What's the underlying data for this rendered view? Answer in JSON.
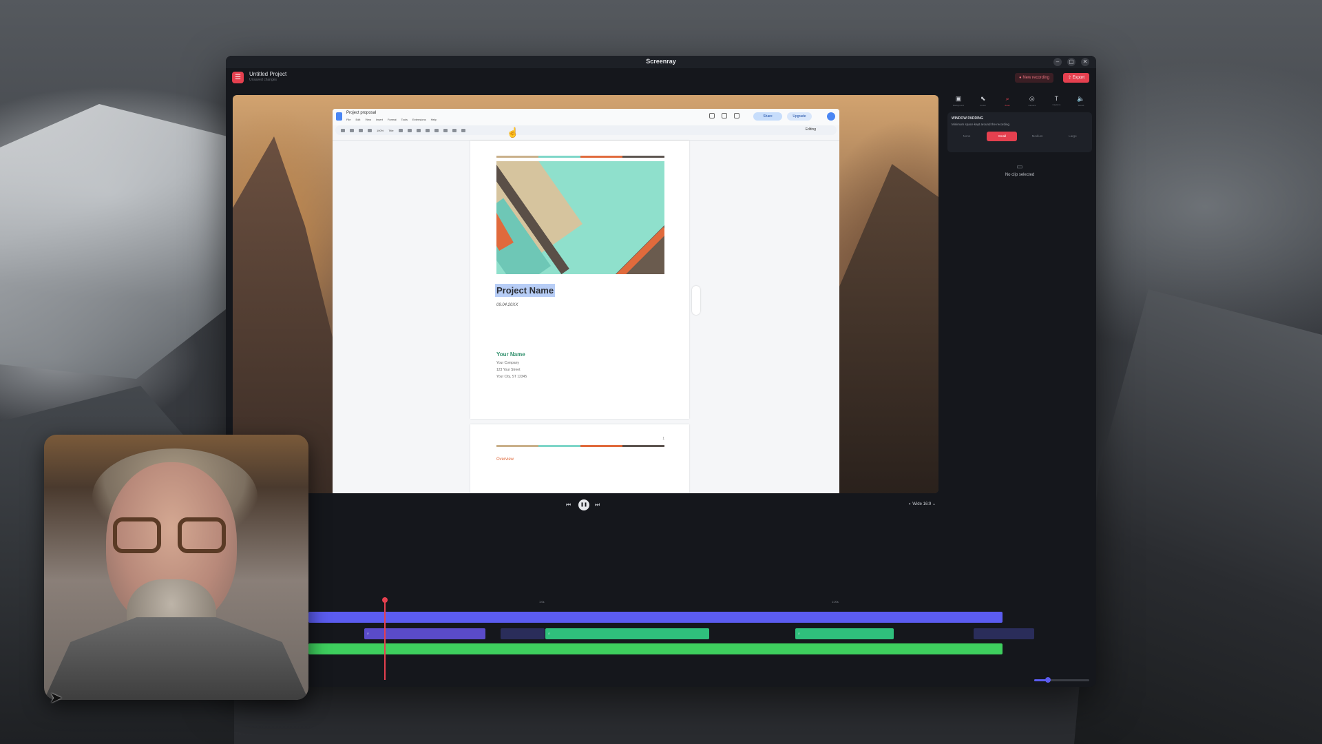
{
  "window": {
    "title": "Screenray"
  },
  "appbar": {
    "project_name": "Untitled Project",
    "project_sub": "Unsaved changes",
    "new_recording_label": "New recording",
    "export_label": "Export"
  },
  "doc": {
    "title": "Project proposal",
    "menus": [
      "File",
      "Edit",
      "View",
      "Insert",
      "Format",
      "Tools",
      "Extensions",
      "Help"
    ],
    "share_label": "Share",
    "upgrade_label": "Upgrade",
    "editing_label": "Editing",
    "zoom": "100%",
    "style": "Title",
    "project_title": "Project Name",
    "date": "09.04.20XX",
    "your_name": "Your Name",
    "address": [
      "Your Company",
      "123 Your Street",
      "Your City, ST 12345"
    ],
    "overview": "Overview",
    "page_number": "1"
  },
  "playback": {
    "aspect_label": "Wide 16:9"
  },
  "panel": {
    "tabs": [
      {
        "icon": "▣",
        "label": "Background",
        "active": false
      },
      {
        "icon": "⬉",
        "label": "Cursor",
        "active": false
      },
      {
        "icon": "⌕",
        "label": "Zoom",
        "active": true
      },
      {
        "icon": "◎",
        "label": "Camera",
        "active": false
      },
      {
        "icon": "T",
        "label": "Captions",
        "active": false
      },
      {
        "icon": "🔈",
        "label": "Sound",
        "active": false
      }
    ],
    "padding_title": "WINDOW PADDING",
    "padding_desc": "Minimum space kept around the recording",
    "padding_options": [
      "None",
      "Small",
      "Medium",
      "Large"
    ],
    "padding_active": "Small",
    "no_clip_label": "No clip selected"
  },
  "timeline": {
    "marks": [
      "1:0s",
      "1:20s"
    ]
  },
  "colors": {
    "accent": "#e5404f",
    "track_main": "#5b5cf0",
    "track_green": "#3ecf5e",
    "clip_teal": "#2fbf7c",
    "clip_purple": "#5a4bc9"
  }
}
